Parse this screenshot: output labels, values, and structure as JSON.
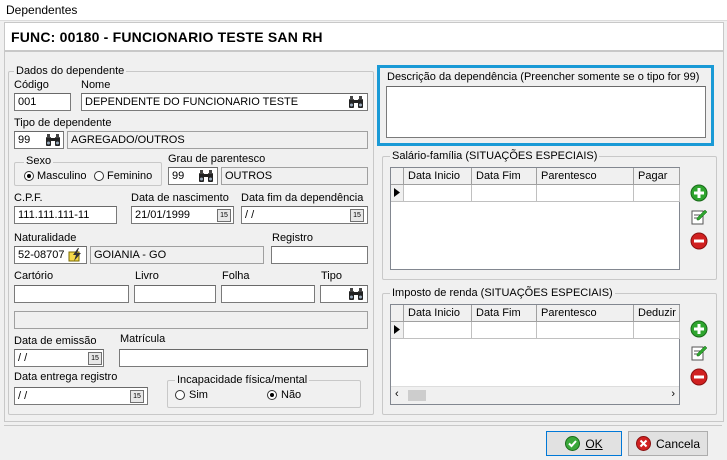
{
  "window": {
    "title": "Dependentes"
  },
  "header": {
    "title": "FUNC:  00180 - FUNCIONARIO TESTE SAN RH"
  },
  "dados": {
    "group_label": "Dados do dependente",
    "codigo_label": "Código",
    "codigo_value": "001",
    "nome_label": "Nome",
    "nome_value": "DEPENDENTE DO FUNCIONARIO TESTE",
    "tipo_label": "Tipo de dependente",
    "tipo_code": "99",
    "tipo_desc": "AGREGADO/OUTROS",
    "sexo_label": "Sexo",
    "sexo_masculino": "Masculino",
    "sexo_feminino": "Feminino",
    "sexo_selected": "Masculino",
    "grau_label": "Grau de parentesco",
    "grau_code": "99",
    "grau_desc": "OUTROS",
    "cpf_label": "C.P.F.",
    "cpf_value": "111.111.111-11",
    "nascimento_label": "Data de nascimento",
    "nascimento_value": "21/01/1999",
    "fim_label": "Data fim da dependência",
    "fim_value": " / /",
    "naturalidade_label": "Naturalidade",
    "naturalidade_code": "52-08707",
    "naturalidade_desc": "GOIANIA - GO",
    "registro_label": "Registro",
    "registro_value": "",
    "cartorio_label": "Cartório",
    "livro_label": "Livro",
    "folha_label": "Folha",
    "tipo2_label": "Tipo",
    "emissao_label": "Data de emissão",
    "emissao_value": " / /",
    "matricula_label": "Matrícula",
    "entrega_label": "Data entrega registro",
    "entrega_value": " / /",
    "incap_label": "Incapacidade física/mental",
    "incap_sim": "Sim",
    "incap_nao": "Não",
    "incap_selected": "Não"
  },
  "descricao": {
    "label": "Descrição da dependência (Preencher somente se o tipo for 99)",
    "value": ""
  },
  "salario": {
    "label": "Salário-família (SITUAÇÕES ESPECIAIS)",
    "columns": [
      "Data Inicio",
      "Data Fim",
      "Parentesco",
      "Pagar"
    ]
  },
  "imposto": {
    "label": "Imposto de renda (SITUAÇÕES ESPECIAIS)",
    "columns": [
      "Data Inicio",
      "Data Fim",
      "Parentesco",
      "Deduzir"
    ]
  },
  "buttons": {
    "ok": "OK",
    "cancel": "Cancela"
  },
  "colors": {
    "highlight": "#1a9ad6",
    "add": "#2ea52e",
    "remove": "#d02020"
  },
  "icons": [
    "binoculars-icon",
    "calendar-icon",
    "lightning-icon",
    "add-icon",
    "edit-icon",
    "remove-icon",
    "ok-check-icon",
    "cancel-x-icon"
  ]
}
